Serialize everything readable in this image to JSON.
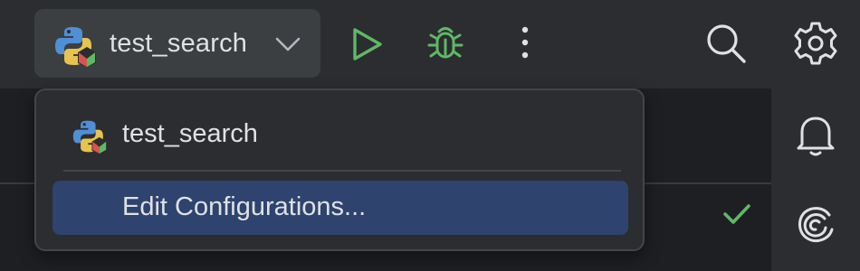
{
  "toolbar": {
    "run_config": {
      "label": "test_search",
      "icon": "python-run-config-icon"
    },
    "run_icon": "play-icon",
    "debug_icon": "bug-icon",
    "more_icon": "more-vertical-icon",
    "search_icon": "search-icon",
    "settings_icon": "gear-icon"
  },
  "popup": {
    "items": [
      {
        "label": "test_search",
        "icon": "python-run-config-icon",
        "selected": false
      },
      {
        "label": "Edit Configurations...",
        "selected": true
      }
    ]
  },
  "right_rail": {
    "icons": [
      "bell-icon",
      "swirl-icon"
    ]
  },
  "editor": {
    "status_icon": "checkmark-icon"
  },
  "colors": {
    "background": "#1e1f22",
    "toolbar": "#2b2d30",
    "run_green": "#5fb865",
    "selection": "#2e436e",
    "text": "#dfe1e5"
  }
}
